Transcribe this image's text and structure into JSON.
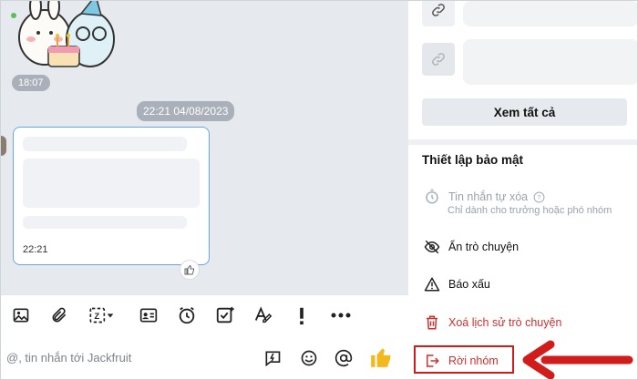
{
  "chat": {
    "time_pill": "18:07",
    "date_pill": "22:21 04/08/2023",
    "bubble_time": "22:21"
  },
  "toolbar": {
    "icons": [
      "image-icon",
      "attachment-icon",
      "screenshot-icon",
      "contact-card-icon",
      "reminder-clock-icon",
      "todo-icon",
      "text-format-icon",
      "important-icon",
      "more-icon"
    ]
  },
  "input": {
    "placeholder": "@, tin nhắn tới Jackfruit"
  },
  "panel": {
    "see_all": "Xem tất cả",
    "security_title": "Thiết lập bảo mật",
    "self_delete": "Tin nhắn tự xóa",
    "self_delete_sub": "Chỉ dành cho trưởng hoặc phó nhóm",
    "hide_chat": "Ẩn trò chuyện",
    "report": "Báo xấu",
    "delete_history": "Xoá lịch sử trò chuyện",
    "leave_group": "Rời nhóm"
  },
  "colors": {
    "danger": "#d22f2f",
    "highlight": "#d21b1b",
    "bubble_border": "#68a6e8"
  }
}
